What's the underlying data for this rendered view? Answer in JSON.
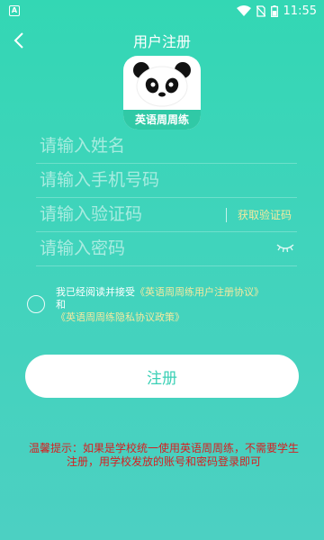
{
  "status_bar": {
    "time": "11:55",
    "left_icon": "android-a-icon",
    "icons": [
      "wifi-icon",
      "no-sim-icon",
      "battery-icon"
    ]
  },
  "nav": {
    "title": "用户注册",
    "back_icon": "chevron-left-icon"
  },
  "logo": {
    "caption": "英语周周练",
    "icon": "panda-icon"
  },
  "form": {
    "name_placeholder": "请输入姓名",
    "phone_placeholder": "请输入手机号码",
    "code_placeholder": "请输入验证码",
    "get_code_label": "获取验证码",
    "password_placeholder": "请输入密码",
    "password_toggle_icon": "eye-closed-icon"
  },
  "agreement": {
    "prefix": "我已经阅读并接受",
    "user_agreement": "《英语周周练用户注册协议》",
    "conjunction": "和",
    "privacy_policy": "《英语周周练隐私协议政策》"
  },
  "register_button": "注册",
  "tip": "温馨提示：如果是学校统一使用英语周周练，不需要学生注册，用学校发放的账号和密码登录即可",
  "colors": {
    "accent": "#3ad0b5",
    "link": "#f4e9a0",
    "warning": "#d61f1f"
  }
}
